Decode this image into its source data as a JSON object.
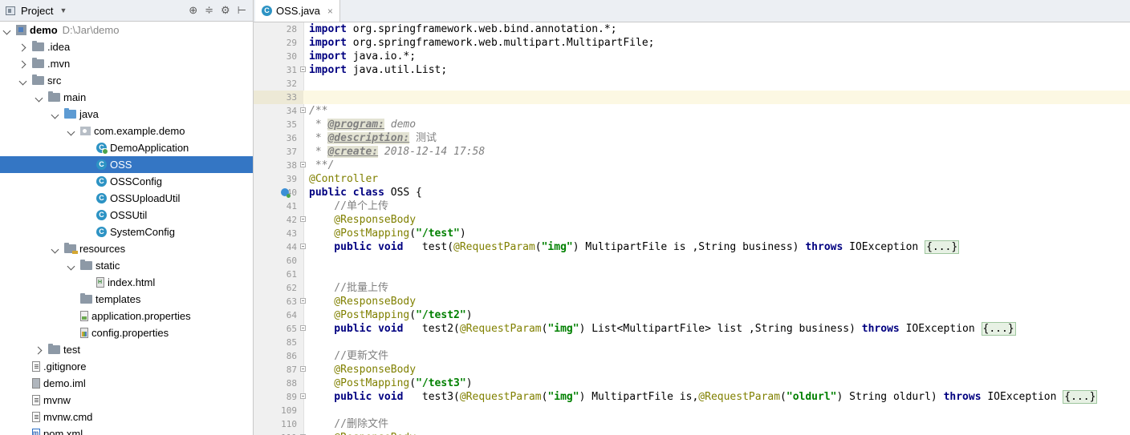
{
  "project_panel": {
    "title": "Project",
    "tools": [
      "⊕",
      "≑",
      "⚙",
      "⊢"
    ],
    "tree": [
      {
        "label": "demo",
        "hint": "D:\\Jar\\demo",
        "depth": 0,
        "arrow": "open",
        "icon": "module",
        "bold": true,
        "name": "tree-item-demo"
      },
      {
        "label": ".idea",
        "depth": 1,
        "arrow": "closed",
        "icon": "folder",
        "name": "tree-item-idea"
      },
      {
        "label": ".mvn",
        "depth": 1,
        "arrow": "closed",
        "icon": "folder",
        "name": "tree-item-mvn"
      },
      {
        "label": "src",
        "depth": 1,
        "arrow": "open",
        "icon": "folder",
        "name": "tree-item-src"
      },
      {
        "label": "main",
        "depth": 2,
        "arrow": "open",
        "icon": "folder",
        "name": "tree-item-main"
      },
      {
        "label": "java",
        "depth": 3,
        "arrow": "open",
        "icon": "folder src",
        "name": "tree-item-java"
      },
      {
        "label": "com.example.demo",
        "depth": 4,
        "arrow": "open",
        "icon": "pkg",
        "name": "tree-item-package"
      },
      {
        "label": "DemoApplication",
        "depth": 5,
        "arrow": "none",
        "icon": "cls app",
        "name": "tree-item-demoapplication"
      },
      {
        "label": "OSS",
        "depth": 5,
        "arrow": "none",
        "icon": "cls",
        "selected": true,
        "name": "tree-item-oss"
      },
      {
        "label": "OSSConfig",
        "depth": 5,
        "arrow": "none",
        "icon": "cls",
        "name": "tree-item-ossconfig"
      },
      {
        "label": "OSSUploadUtil",
        "depth": 5,
        "arrow": "none",
        "icon": "cls",
        "name": "tree-item-ossuploadutil"
      },
      {
        "label": "OSSUtil",
        "depth": 5,
        "arrow": "none",
        "icon": "cls",
        "name": "tree-item-ossutil"
      },
      {
        "label": "SystemConfig",
        "depth": 5,
        "arrow": "none",
        "icon": "cls",
        "name": "tree-item-systemconfig"
      },
      {
        "label": "resources",
        "depth": 3,
        "arrow": "open",
        "icon": "folder res",
        "name": "tree-item-resources"
      },
      {
        "label": "static",
        "depth": 4,
        "arrow": "open",
        "icon": "folder",
        "name": "tree-item-static"
      },
      {
        "label": "index.html",
        "depth": 5,
        "arrow": "none",
        "icon": "file html",
        "name": "tree-item-index-html"
      },
      {
        "label": "templates",
        "depth": 4,
        "arrow": "none",
        "icon": "folder",
        "name": "tree-item-templates"
      },
      {
        "label": "application.properties",
        "depth": 4,
        "arrow": "none",
        "icon": "file props",
        "name": "tree-item-application-properties"
      },
      {
        "label": "config.properties",
        "depth": 4,
        "arrow": "none",
        "icon": "file cfg",
        "name": "tree-item-config-properties"
      },
      {
        "label": "test",
        "depth": 2,
        "arrow": "closed",
        "icon": "folder",
        "name": "tree-item-test"
      },
      {
        "label": ".gitignore",
        "depth": 1,
        "arrow": "none",
        "icon": "file text",
        "name": "tree-item-gitignore"
      },
      {
        "label": "demo.iml",
        "depth": 1,
        "arrow": "none",
        "icon": "file iml",
        "name": "tree-item-demo-iml"
      },
      {
        "label": "mvnw",
        "depth": 1,
        "arrow": "none",
        "icon": "file text",
        "name": "tree-item-mvnw"
      },
      {
        "label": "mvnw.cmd",
        "depth": 1,
        "arrow": "none",
        "icon": "file text",
        "name": "tree-item-mvnw-cmd"
      },
      {
        "label": "pom.xml",
        "depth": 1,
        "arrow": "none",
        "icon": "file mvn xml",
        "name": "tree-item-pom-xml"
      }
    ]
  },
  "editor": {
    "tab": {
      "label": "OSS.java",
      "close": "×"
    },
    "lines": [
      {
        "no": "28",
        "segs": [
          [
            "kw",
            "import"
          ],
          [
            "",
            "org.springframework.web.bind.annotation.*;"
          ]
        ]
      },
      {
        "no": "29",
        "segs": [
          [
            "kw",
            "import"
          ],
          [
            "",
            "org.springframework.web.multipart.MultipartFile;"
          ]
        ]
      },
      {
        "no": "30",
        "segs": [
          [
            "kw",
            "import"
          ],
          [
            "",
            "java.io.*;"
          ]
        ]
      },
      {
        "no": "31",
        "fold": true,
        "segs": [
          [
            "kw",
            "import"
          ],
          [
            "",
            "java.util.List;"
          ]
        ]
      },
      {
        "no": "32",
        "segs": []
      },
      {
        "no": "33",
        "segs": []
      },
      {
        "no": "34",
        "fold": true,
        "segs": [
          [
            "cmt",
            "/**"
          ]
        ]
      },
      {
        "no": "35",
        "segs": [
          [
            "cmt",
            " * "
          ],
          [
            "doctag",
            "@program:"
          ],
          [
            "cmt",
            " demo"
          ]
        ]
      },
      {
        "no": "36",
        "segs": [
          [
            "cmt",
            " * "
          ],
          [
            "doctag",
            "@description:"
          ],
          [
            "cmt-plain",
            " 测试"
          ]
        ]
      },
      {
        "no": "37",
        "segs": [
          [
            "cmt",
            " * "
          ],
          [
            "doctag",
            "@create:"
          ],
          [
            "cmt",
            " 2018-12-14 17:58"
          ]
        ]
      },
      {
        "no": "38",
        "fold": true,
        "segs": [
          [
            "cmt",
            " **/"
          ]
        ]
      },
      {
        "no": "39",
        "segs": [
          [
            "ann",
            "@Controller"
          ]
        ]
      },
      {
        "no": "40",
        "run": true,
        "segs": [
          [
            "kw",
            "public class"
          ],
          [
            "",
            " OSS {"
          ]
        ]
      },
      {
        "no": "41",
        "segs": [
          [
            "cmt-plain",
            "    //单个上传"
          ]
        ]
      },
      {
        "no": "42",
        "fold": true,
        "segs": [
          [
            "ann",
            "    @ResponseBody"
          ]
        ]
      },
      {
        "no": "43",
        "segs": [
          [
            "ann",
            "    @PostMapping"
          ],
          [
            "",
            "("
          ],
          [
            "str",
            "\"/test\""
          ],
          [
            "",
            ")"
          ]
        ]
      },
      {
        "no": "44",
        "fold": true,
        "segs": [
          [
            "kw",
            "    public void"
          ],
          [
            "",
            "   test("
          ],
          [
            "ann",
            "@RequestParam"
          ],
          [
            "",
            "("
          ],
          [
            "str",
            "\"img\""
          ],
          [
            "",
            ") MultipartFile is ,String business) "
          ],
          [
            "kw",
            "throws"
          ],
          [
            "",
            " IOException "
          ],
          [
            "fold-ph",
            "{...}"
          ]
        ]
      },
      {
        "no": "60",
        "segs": []
      },
      {
        "no": "61",
        "segs": []
      },
      {
        "no": "62",
        "segs": [
          [
            "cmt-plain",
            "    //批量上传"
          ]
        ]
      },
      {
        "no": "63",
        "fold": true,
        "segs": [
          [
            "ann",
            "    @ResponseBody"
          ]
        ]
      },
      {
        "no": "64",
        "segs": [
          [
            "ann",
            "    @PostMapping"
          ],
          [
            "",
            "("
          ],
          [
            "str",
            "\"/test2\""
          ],
          [
            "",
            ")"
          ]
        ]
      },
      {
        "no": "65",
        "fold": true,
        "segs": [
          [
            "kw",
            "    public void"
          ],
          [
            "",
            "   test2("
          ],
          [
            "ann",
            "@RequestParam"
          ],
          [
            "",
            "("
          ],
          [
            "str",
            "\"img\""
          ],
          [
            "",
            ") List<MultipartFile> list ,String business) "
          ],
          [
            "kw",
            "throws"
          ],
          [
            "",
            " IOException "
          ],
          [
            "fold-ph",
            "{...}"
          ]
        ]
      },
      {
        "no": "85",
        "segs": []
      },
      {
        "no": "86",
        "segs": [
          [
            "cmt-plain",
            "    //更新文件"
          ]
        ]
      },
      {
        "no": "87",
        "fold": true,
        "segs": [
          [
            "ann",
            "    @ResponseBody"
          ]
        ]
      },
      {
        "no": "88",
        "segs": [
          [
            "ann",
            "    @PostMapping"
          ],
          [
            "",
            "("
          ],
          [
            "str",
            "\"/test3\""
          ],
          [
            "",
            ")"
          ]
        ]
      },
      {
        "no": "89",
        "fold": true,
        "segs": [
          [
            "kw",
            "    public void"
          ],
          [
            "",
            "   test3("
          ],
          [
            "ann",
            "@RequestParam"
          ],
          [
            "",
            "("
          ],
          [
            "str",
            "\"img\""
          ],
          [
            "",
            ") MultipartFile is,"
          ],
          [
            "ann",
            "@RequestParam"
          ],
          [
            "",
            "("
          ],
          [
            "str",
            "\"oldurl\""
          ],
          [
            "",
            ") String oldurl) "
          ],
          [
            "kw",
            "throws"
          ],
          [
            "",
            " IOException "
          ],
          [
            "fold-ph",
            "{...}"
          ]
        ]
      },
      {
        "no": "109",
        "segs": []
      },
      {
        "no": "110",
        "segs": [
          [
            "cmt-plain",
            "    //删除文件"
          ]
        ]
      },
      {
        "no": "111",
        "fold": true,
        "segs": [
          [
            "ann",
            "    @ResponseBody"
          ]
        ]
      }
    ]
  }
}
